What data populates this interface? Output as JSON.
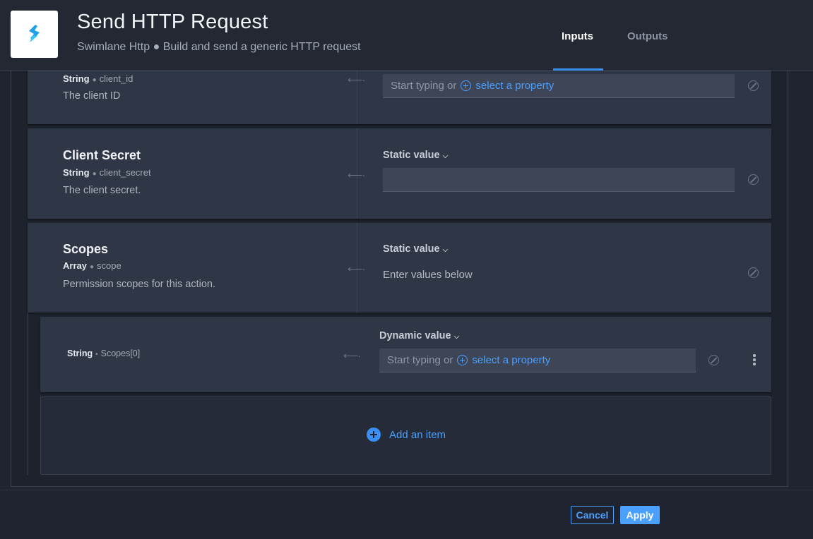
{
  "header": {
    "title": "Send HTTP Request",
    "subtitle": "Swimlane Http ● Build and send a generic HTTP request",
    "tabs": [
      {
        "label": "Inputs",
        "active": true
      },
      {
        "label": "Outputs",
        "active": false
      }
    ]
  },
  "fields": {
    "client_id": {
      "type": "String",
      "key": "client_id",
      "description": "The client ID",
      "placeholder_prefix": "Start typing or",
      "placeholder_link": "select a property"
    },
    "client_secret": {
      "title": "Client Secret",
      "type": "String",
      "key": "client_secret",
      "description": "The client secret.",
      "value_type": "Static value",
      "value": ""
    },
    "scopes": {
      "title": "Scopes",
      "type": "Array",
      "key": "scope",
      "description": "Permission scopes for this action.",
      "value_type": "Static value",
      "value_hint": "Enter values below",
      "items": [
        {
          "type": "String",
          "key": "Scopes[0]",
          "value_type": "Dynamic value",
          "placeholder_prefix": "Start typing or",
          "placeholder_link": "select a property"
        }
      ],
      "add_item_label": "Add an item"
    }
  },
  "footer": {
    "cancel_label": "Cancel",
    "apply_label": "Apply"
  },
  "colors": {
    "accent": "#4aa0ff",
    "background": "#1f2430",
    "card": "#2f3646"
  }
}
